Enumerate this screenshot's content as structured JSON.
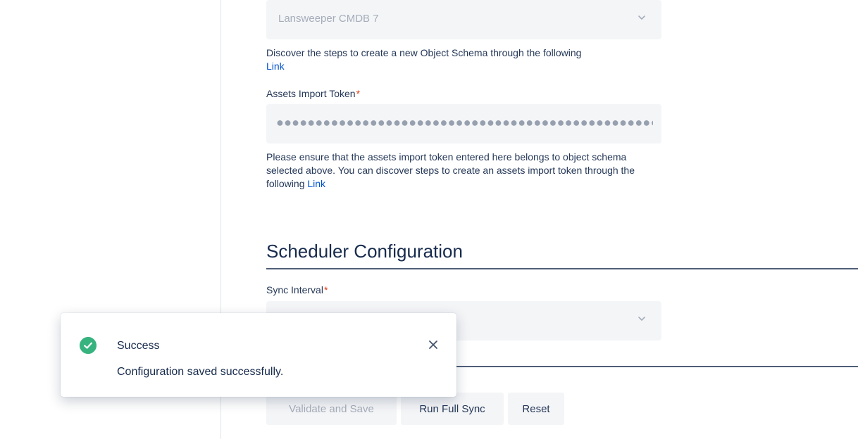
{
  "schema_select": {
    "value": "Lansweeper CMDB 7",
    "icon": "chevron-down-icon"
  },
  "schema_help": {
    "text": "Discover the steps to create a new Object Schema through the following",
    "link": "Link"
  },
  "token_field": {
    "label": "Assets Import Token",
    "required_mark": "*",
    "masked_value": "●●●●●●●●●●●●●●●●●●●●●●●●●●●●●●●●●●●●●●●●●●●●●●●●●●●"
  },
  "token_help": {
    "text": "Please ensure that the assets import token entered here belongs to object schema selected above. You can discover steps to create an assets import token through the following",
    "link": "Link"
  },
  "scheduler": {
    "title": "Scheduler Configuration",
    "sync_label": "Sync Interval",
    "required_mark": "*",
    "sync_value": ""
  },
  "actions": {
    "validate_label": "Validate and Save",
    "run_sync_label": "Run Full Sync",
    "reset_label": "Reset"
  },
  "toast": {
    "title": "Success",
    "message": "Configuration saved successfully.",
    "status_color": "#36b37e",
    "status_icon": "check-circle-icon",
    "close_icon": "close-icon"
  }
}
